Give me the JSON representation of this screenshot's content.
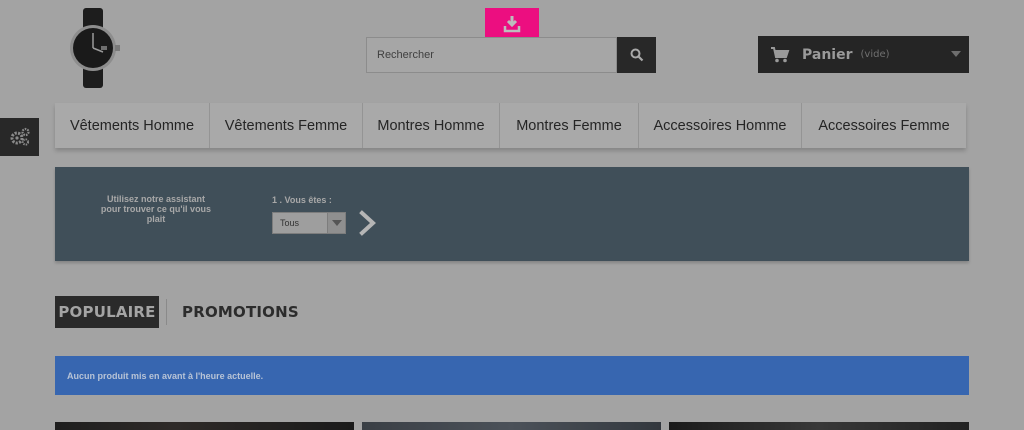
{
  "header": {
    "search": {
      "placeholder": "Rechercher"
    },
    "cart": {
      "label": "Panier",
      "status": "(vide)"
    }
  },
  "menu": {
    "items": [
      {
        "label": "Vêtements Homme"
      },
      {
        "label": "Vêtements Femme"
      },
      {
        "label": "Montres Homme"
      },
      {
        "label": "Montres Femme"
      },
      {
        "label": "Accessoires Homme"
      },
      {
        "label": "Accessoires Femme"
      }
    ]
  },
  "assistant": {
    "intro": "Utilisez notre assistant pour trouver ce qu'il vous plait",
    "step_label": "1 . Vous êtes :",
    "select_value": "Tous"
  },
  "tabs": {
    "popular": "POPULAIRE",
    "promotions": "PROMOTIONS"
  },
  "alert": {
    "message": "Aucun produit mis en avant à l'heure actuelle."
  },
  "colors": {
    "page_bg": "#a3a3a3",
    "download_badge": "#ec0e80",
    "assistant_bg": "#404f59",
    "alert_bg": "#3766b0",
    "dark": "#282828"
  },
  "icons": {
    "download": "download-icon",
    "search": "search-icon",
    "cart": "cart-icon",
    "settings": "gears-icon",
    "next": "chevron-right-icon"
  }
}
